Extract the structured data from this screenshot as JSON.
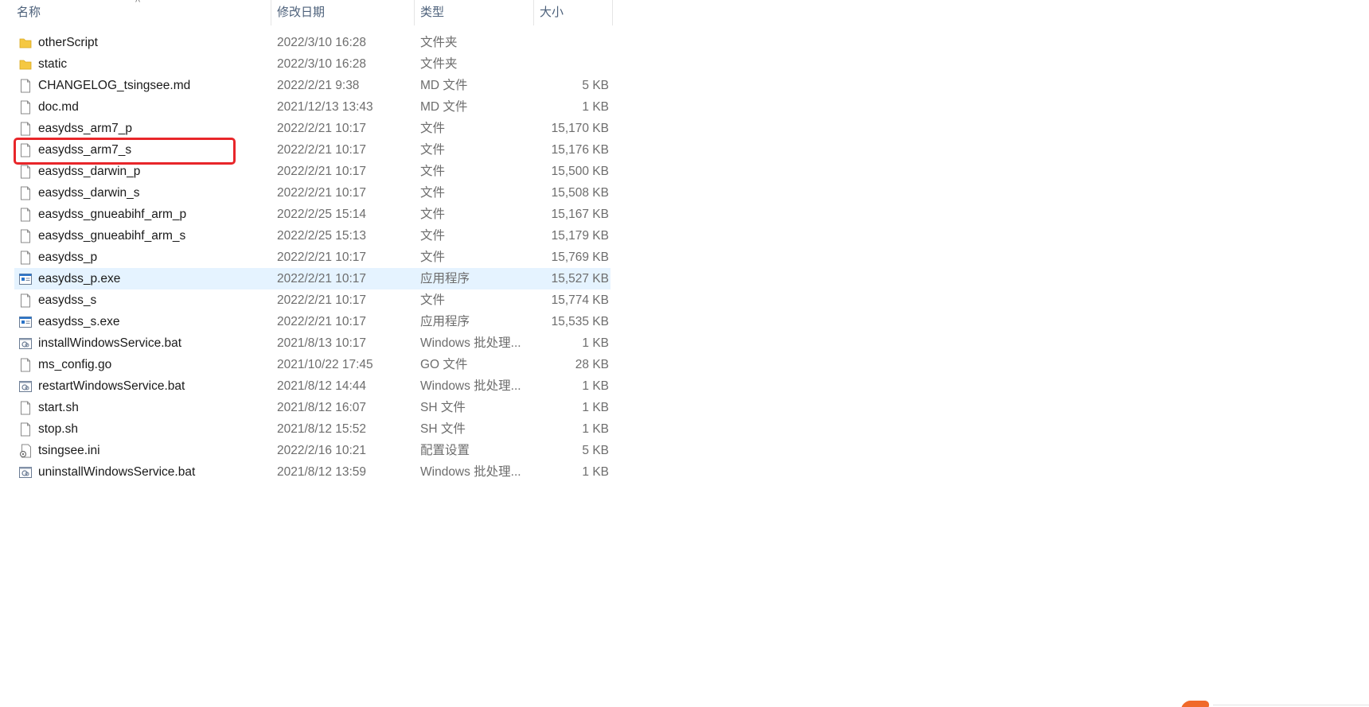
{
  "columns": {
    "name": "名称",
    "date": "修改日期",
    "type": "类型",
    "size": "大小"
  },
  "sort_indicator": "^",
  "files": [
    {
      "name": "otherScript",
      "date": "2022/3/10 16:28",
      "type": "文件夹",
      "size": "",
      "icon": "folder-icon"
    },
    {
      "name": "static",
      "date": "2022/3/10 16:28",
      "type": "文件夹",
      "size": "",
      "icon": "folder-icon"
    },
    {
      "name": "CHANGELOG_tsingsee.md",
      "date": "2022/2/21 9:38",
      "type": "MD 文件",
      "size": "5 KB",
      "icon": "file-icon"
    },
    {
      "name": "doc.md",
      "date": "2021/12/13 13:43",
      "type": "MD 文件",
      "size": "1 KB",
      "icon": "file-icon"
    },
    {
      "name": "easydss_arm7_p",
      "date": "2022/2/21 10:17",
      "type": "文件",
      "size": "15,170 KB",
      "icon": "file-icon"
    },
    {
      "name": "easydss_arm7_s",
      "date": "2022/2/21 10:17",
      "type": "文件",
      "size": "15,176 KB",
      "icon": "file-icon"
    },
    {
      "name": "easydss_darwin_p",
      "date": "2022/2/21 10:17",
      "type": "文件",
      "size": "15,500 KB",
      "icon": "file-icon"
    },
    {
      "name": "easydss_darwin_s",
      "date": "2022/2/21 10:17",
      "type": "文件",
      "size": "15,508 KB",
      "icon": "file-icon"
    },
    {
      "name": "easydss_gnueabihf_arm_p",
      "date": "2022/2/25 15:14",
      "type": "文件",
      "size": "15,167 KB",
      "icon": "file-icon"
    },
    {
      "name": "easydss_gnueabihf_arm_s",
      "date": "2022/2/25 15:13",
      "type": "文件",
      "size": "15,179 KB",
      "icon": "file-icon"
    },
    {
      "name": "easydss_p",
      "date": "2022/2/21 10:17",
      "type": "文件",
      "size": "15,769 KB",
      "icon": "file-icon"
    },
    {
      "name": "easydss_p.exe",
      "date": "2022/2/21 10:17",
      "type": "应用程序",
      "size": "15,527 KB",
      "icon": "exe-icon",
      "selected": true
    },
    {
      "name": "easydss_s",
      "date": "2022/2/21 10:17",
      "type": "文件",
      "size": "15,774 KB",
      "icon": "file-icon"
    },
    {
      "name": "easydss_s.exe",
      "date": "2022/2/21 10:17",
      "type": "应用程序",
      "size": "15,535 KB",
      "icon": "exe-icon"
    },
    {
      "name": "installWindowsService.bat",
      "date": "2021/8/13 10:17",
      "type": "Windows 批处理...",
      "size": "1 KB",
      "icon": "bat-icon"
    },
    {
      "name": "ms_config.go",
      "date": "2021/10/22 17:45",
      "type": "GO 文件",
      "size": "28 KB",
      "icon": "file-icon"
    },
    {
      "name": "restartWindowsService.bat",
      "date": "2021/8/12 14:44",
      "type": "Windows 批处理...",
      "size": "1 KB",
      "icon": "bat-icon"
    },
    {
      "name": "start.sh",
      "date": "2021/8/12 16:07",
      "type": "SH 文件",
      "size": "1 KB",
      "icon": "file-icon"
    },
    {
      "name": "stop.sh",
      "date": "2021/8/12 15:52",
      "type": "SH 文件",
      "size": "1 KB",
      "icon": "file-icon"
    },
    {
      "name": "tsingsee.ini",
      "date": "2022/2/16 10:21",
      "type": "配置设置",
      "size": "5 KB",
      "icon": "ini-icon"
    },
    {
      "name": "uninstallWindowsService.bat",
      "date": "2021/8/12 13:59",
      "type": "Windows 批处理...",
      "size": "1 KB",
      "icon": "bat-icon"
    }
  ],
  "annotation": {
    "highlighted_file": "easydss_arm7_s",
    "color": "#e8262a"
  },
  "colors": {
    "selected_row": "#e5f3ff",
    "folder": "#f5c842",
    "secondary_text": "#6d6d6d"
  }
}
